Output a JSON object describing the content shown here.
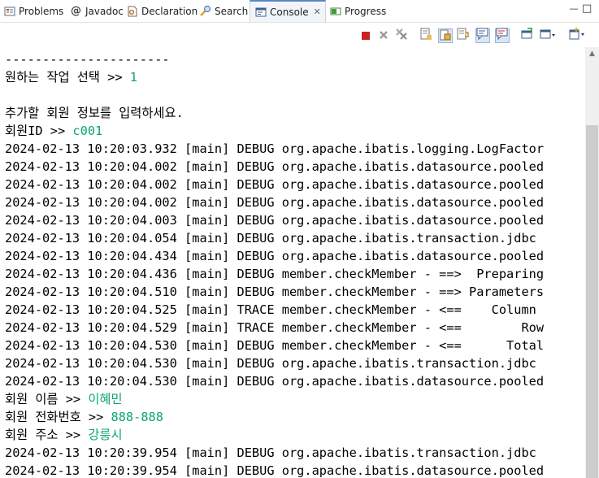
{
  "tabs": [
    {
      "label": "Problems",
      "icon": "problems-icon"
    },
    {
      "label": "Javadoc",
      "icon": "javadoc-icon"
    },
    {
      "label": "Declaration",
      "icon": "declaration-icon"
    },
    {
      "label": "Search",
      "icon": "search-icon"
    },
    {
      "label": "Console",
      "icon": "console-icon",
      "active": true
    },
    {
      "label": "Progress",
      "icon": "progress-icon"
    }
  ],
  "tab_glyphs": {
    "javadoc": "@",
    "close": "✕"
  },
  "window_controls": {
    "minimize": "—",
    "maximize": "□"
  },
  "toolbar_icons": [
    "terminate-icon",
    "remove-launch-icon",
    "remove-all-terminated-icon",
    "clear-console-icon",
    "scroll-lock-icon",
    "word-wrap-icon",
    "show-console-on-stdout-icon",
    "show-console-on-stderr-icon",
    "pin-console-icon",
    "display-selected-console-icon",
    "open-console-icon"
  ],
  "colors": {
    "accent": "#5a86c0",
    "user_input": "#0aa478",
    "terminate": "#cc2222",
    "toolbar_pressed": "#dbe6f4"
  },
  "console": {
    "separator": "----------------------",
    "lines": [
      {
        "prefix": "원하는 작업 선택 >> ",
        "input": "1"
      },
      {
        "prefix": "",
        "input": ""
      },
      {
        "prefix": "추가할 회원 정보를 입력하세요.",
        "input": ""
      },
      {
        "prefix": "회원ID >> ",
        "input": "c001"
      },
      {
        "prefix": "2024-02-13 10:20:03.932 [main] DEBUG org.apache.ibatis.logging.LogFactor",
        "input": ""
      },
      {
        "prefix": "2024-02-13 10:20:04.002 [main] DEBUG org.apache.ibatis.datasource.pooled",
        "input": ""
      },
      {
        "prefix": "2024-02-13 10:20:04.002 [main] DEBUG org.apache.ibatis.datasource.pooled",
        "input": ""
      },
      {
        "prefix": "2024-02-13 10:20:04.002 [main] DEBUG org.apache.ibatis.datasource.pooled",
        "input": ""
      },
      {
        "prefix": "2024-02-13 10:20:04.003 [main] DEBUG org.apache.ibatis.datasource.pooled",
        "input": ""
      },
      {
        "prefix": "2024-02-13 10:20:04.054 [main] DEBUG org.apache.ibatis.transaction.jdbc",
        "input": ""
      },
      {
        "prefix": "2024-02-13 10:20:04.434 [main] DEBUG org.apache.ibatis.datasource.pooled",
        "input": ""
      },
      {
        "prefix": "2024-02-13 10:20:04.436 [main] DEBUG member.checkMember - ==>  Preparing",
        "input": ""
      },
      {
        "prefix": "2024-02-13 10:20:04.510 [main] DEBUG member.checkMember - ==> Parameters",
        "input": ""
      },
      {
        "prefix": "2024-02-13 10:20:04.525 [main] TRACE member.checkMember - <==    Column",
        "input": ""
      },
      {
        "prefix": "2024-02-13 10:20:04.529 [main] TRACE member.checkMember - <==        Row",
        "input": ""
      },
      {
        "prefix": "2024-02-13 10:20:04.530 [main] DEBUG member.checkMember - <==      Total",
        "input": ""
      },
      {
        "prefix": "2024-02-13 10:20:04.530 [main] DEBUG org.apache.ibatis.transaction.jdbc",
        "input": ""
      },
      {
        "prefix": "2024-02-13 10:20:04.530 [main] DEBUG org.apache.ibatis.datasource.pooled",
        "input": ""
      },
      {
        "prefix": "회원 이름 >> ",
        "input": "이혜민"
      },
      {
        "prefix": "회원 전화번호 >> ",
        "input": "888-888"
      },
      {
        "prefix": "회원 주소 >> ",
        "input": "강릉시"
      },
      {
        "prefix": "2024-02-13 10:20:39.954 [main] DEBUG org.apache.ibatis.transaction.jdbc",
        "input": ""
      },
      {
        "prefix": "2024-02-13 10:20:39.954 [main] DEBUG org.apache.ibatis.datasource.pooled",
        "input": ""
      }
    ]
  }
}
